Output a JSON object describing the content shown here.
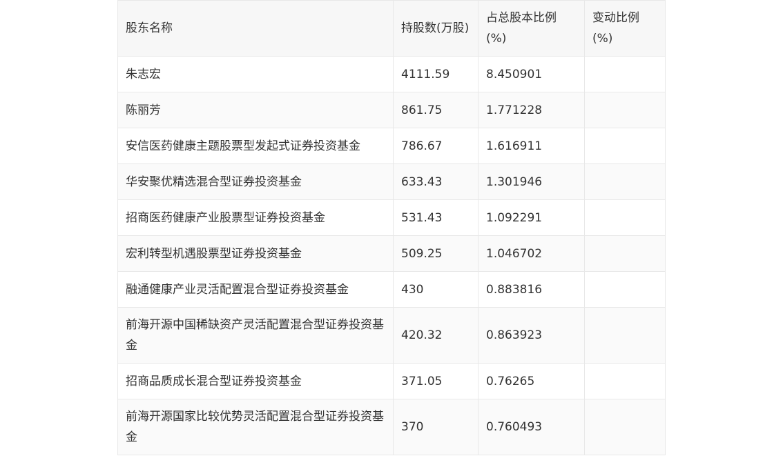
{
  "table": {
    "headers": [
      "股东名称",
      "持股数(万股)",
      "占总股本比例(%)",
      "变动比例(%)"
    ],
    "rows": [
      [
        "朱志宏",
        "4111.59",
        "8.450901",
        ""
      ],
      [
        "陈丽芳",
        "861.75",
        "1.771228",
        ""
      ],
      [
        "安信医药健康主题股票型发起式证券投资基金",
        "786.67",
        "1.616911",
        ""
      ],
      [
        "华安聚优精选混合型证券投资基金",
        "633.43",
        "1.301946",
        ""
      ],
      [
        "招商医药健康产业股票型证券投资基金",
        "531.43",
        "1.092291",
        ""
      ],
      [
        "宏利转型机遇股票型证券投资基金",
        "509.25",
        "1.046702",
        ""
      ],
      [
        "融通健康产业灵活配置混合型证券投资基金",
        "430",
        "0.883816",
        ""
      ],
      [
        "前海开源中国稀缺资产灵活配置混合型证券投资基金",
        "420.32",
        "0.863923",
        ""
      ],
      [
        "招商品质成长混合型证券投资基金",
        "371.05",
        "0.76265",
        ""
      ],
      [
        "前海开源国家比较优势灵活配置混合型证券投资基金",
        "370",
        "0.760493",
        ""
      ]
    ]
  }
}
